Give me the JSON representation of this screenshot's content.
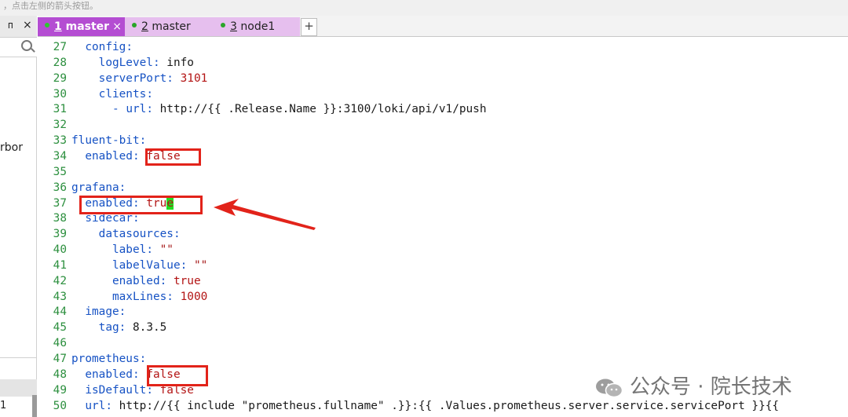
{
  "top_hint": "，点击左侧的箭头按钮。",
  "left_panel": {
    "pin_glyph": "ᴨ",
    "close_glyph": "×",
    "partial_text": "rbor",
    "partial_number": "1"
  },
  "tabs": [
    {
      "number": "1",
      "label": "master",
      "active": true,
      "close": "×"
    },
    {
      "number": "2",
      "label": "master",
      "active": false
    },
    {
      "number": "3",
      "label": "node1",
      "active": false
    }
  ],
  "add_tab": "+",
  "lines": [
    {
      "n": "27",
      "indent": "  ",
      "key": "config",
      "sep": ":",
      "val": "",
      "vtype": ""
    },
    {
      "n": "28",
      "indent": "    ",
      "key": "logLevel",
      "sep": ":",
      "val": " info",
      "vtype": "v"
    },
    {
      "n": "29",
      "indent": "    ",
      "key": "serverPort",
      "sep": ":",
      "val": " 3101",
      "vtype": "n"
    },
    {
      "n": "30",
      "indent": "    ",
      "key": "clients",
      "sep": ":",
      "val": "",
      "vtype": ""
    },
    {
      "n": "31",
      "indent": "      - ",
      "key": "url",
      "sep": ":",
      "val": " http://{{ .Release.Name }}:3100/loki/api/v1/push",
      "vtype": "v"
    },
    {
      "n": "32",
      "indent": "",
      "key": "",
      "sep": "",
      "val": "",
      "vtype": ""
    },
    {
      "n": "33",
      "indent": "",
      "key": "fluent-bit",
      "sep": ":",
      "val": "",
      "vtype": ""
    },
    {
      "n": "34",
      "indent": "  ",
      "key": "enabled",
      "sep": ":",
      "val": " false",
      "vtype": "n"
    },
    {
      "n": "35",
      "indent": "",
      "key": "",
      "sep": "",
      "val": "",
      "vtype": ""
    },
    {
      "n": "36",
      "indent": "",
      "key": "grafana",
      "sep": ":",
      "val": "",
      "vtype": ""
    },
    {
      "n": "37",
      "indent": "  ",
      "key": "enabled",
      "sep": ":",
      "val": " tru",
      "vtype": "n",
      "cursor": "e"
    },
    {
      "n": "38",
      "indent": "  ",
      "key": "sidecar",
      "sep": ":",
      "val": "",
      "vtype": ""
    },
    {
      "n": "39",
      "indent": "    ",
      "key": "datasources",
      "sep": ":",
      "val": "",
      "vtype": ""
    },
    {
      "n": "40",
      "indent": "      ",
      "key": "label",
      "sep": ":",
      "val": " \"\"",
      "vtype": "s"
    },
    {
      "n": "41",
      "indent": "      ",
      "key": "labelValue",
      "sep": ":",
      "val": " \"\"",
      "vtype": "s"
    },
    {
      "n": "42",
      "indent": "      ",
      "key": "enabled",
      "sep": ":",
      "val": " true",
      "vtype": "n"
    },
    {
      "n": "43",
      "indent": "      ",
      "key": "maxLines",
      "sep": ":",
      "val": " 1000",
      "vtype": "n"
    },
    {
      "n": "44",
      "indent": "  ",
      "key": "image",
      "sep": ":",
      "val": "",
      "vtype": ""
    },
    {
      "n": "45",
      "indent": "    ",
      "key": "tag",
      "sep": ":",
      "val": " 8.3.5",
      "vtype": "v"
    },
    {
      "n": "46",
      "indent": "",
      "key": "",
      "sep": "",
      "val": "",
      "vtype": ""
    },
    {
      "n": "47",
      "indent": "",
      "key": "prometheus",
      "sep": ":",
      "val": "",
      "vtype": ""
    },
    {
      "n": "48",
      "indent": "  ",
      "key": "enabled",
      "sep": ":",
      "val": " false",
      "vtype": "n"
    },
    {
      "n": "49",
      "indent": "  ",
      "key": "isDefault",
      "sep": ":",
      "val": " false",
      "vtype": "n"
    },
    {
      "n": "50",
      "indent": "  ",
      "key": "url",
      "sep": ":",
      "val": " http://{{ include \"prometheus.fullname\" .}}:{{ .Values.prometheus.server.service.servicePort }}{{",
      "vtype": "v"
    }
  ],
  "watermark": "公众号 · 院长技术",
  "colors": {
    "accent_tab": "#b44dd2",
    "highlight": "#e2231a",
    "cursor": "#22dd22",
    "key": "#1652c4",
    "number": "#b31414",
    "line_number": "#2c8f3e"
  }
}
